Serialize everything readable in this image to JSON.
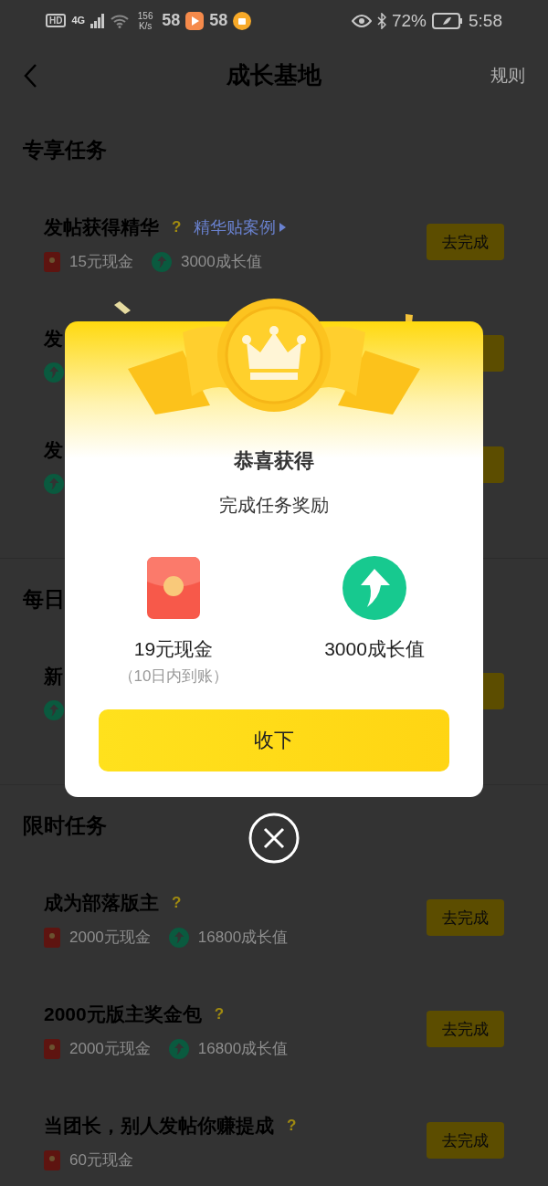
{
  "status_bar": {
    "hd_badge": "HD",
    "network": "4G",
    "speed": "156 K/s",
    "counts": [
      "58",
      "58"
    ],
    "battery": "72%",
    "time": "5:58"
  },
  "nav": {
    "title": "成长基地",
    "action": "规则"
  },
  "sections": [
    {
      "title": "专享任务",
      "tasks": [
        {
          "title": "发帖获得精华",
          "help": "?",
          "link": "精华贴案例",
          "rewards": [
            {
              "kind": "cash",
              "text": "15元现金"
            },
            {
              "kind": "growth",
              "text": "3000成长值"
            }
          ],
          "button": "去完成"
        },
        {
          "title": "发",
          "rewards": [
            {
              "kind": "growth"
            }
          ],
          "has_button": true
        },
        {
          "title": "发",
          "rewards": [
            {
              "kind": "growth"
            }
          ],
          "has_button": true
        }
      ]
    },
    {
      "title": "每日",
      "tasks": [
        {
          "title": "新",
          "rewards": [
            {
              "kind": "growth"
            }
          ],
          "has_button": true
        }
      ]
    },
    {
      "title": "限时任务",
      "tasks": [
        {
          "title": "成为部落版主",
          "help": "?",
          "rewards": [
            {
              "kind": "cash",
              "text": "2000元现金"
            },
            {
              "kind": "growth",
              "text": "16800成长值"
            }
          ],
          "button": "去完成"
        },
        {
          "title": "2000元版主奖金包",
          "help": "?",
          "rewards": [
            {
              "kind": "cash",
              "text": "2000元现金"
            },
            {
              "kind": "growth",
              "text": "16800成长值"
            }
          ],
          "button": "去完成"
        },
        {
          "title": "当团长，别人发帖你赚提成",
          "help": "?",
          "rewards": [
            {
              "kind": "cash",
              "text": "60元现金"
            }
          ],
          "button": "去完成"
        }
      ]
    }
  ],
  "modal": {
    "title": "恭喜获得",
    "subtitle": "完成任务奖励",
    "rewards": [
      {
        "kind": "cash",
        "label": "19元现金",
        "note": "（10日内到账）"
      },
      {
        "kind": "growth",
        "label": "3000成长值"
      }
    ],
    "button": "收下"
  }
}
